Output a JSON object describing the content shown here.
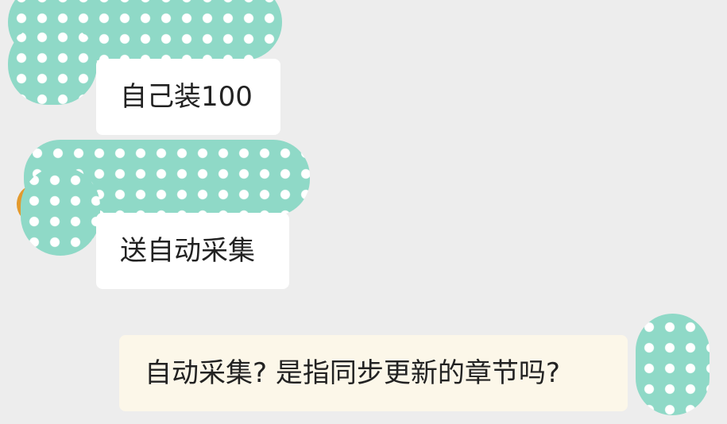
{
  "messages": [
    {
      "direction": "incoming",
      "text": "自己装100"
    },
    {
      "direction": "incoming",
      "text": "送自动采集"
    },
    {
      "direction": "outgoing",
      "text": "自动采集? 是指同步更新的章节吗?"
    }
  ],
  "colors": {
    "background": "#ededed",
    "incoming_bubble": "#ffffff",
    "outgoing_bubble": "#fcf7e9",
    "mask": "#8fd9c7",
    "mask_dot": "#ffffff",
    "avatar_accent": "#e39a2e"
  }
}
